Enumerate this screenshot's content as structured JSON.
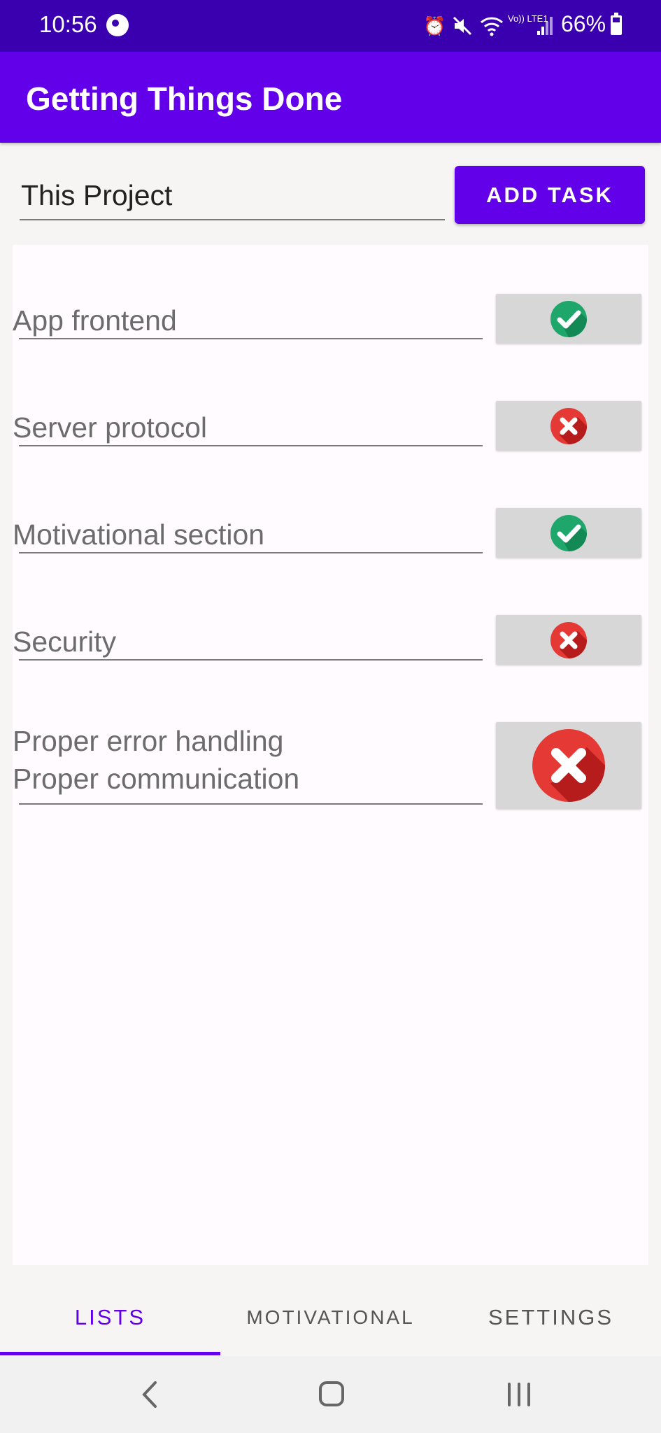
{
  "status_bar": {
    "time": "10:56",
    "battery": "66%",
    "volte_label": "Vo)) LTE1",
    "icons": [
      "app-notification-icon",
      "alarm-icon",
      "mute-icon",
      "wifi-icon",
      "volte-icon",
      "signal-icon",
      "battery-icon"
    ]
  },
  "app_bar": {
    "title": "Getting Things Done"
  },
  "project": {
    "name": "This Project",
    "add_task_label": "ADD TASK"
  },
  "tasks": [
    {
      "name": "App frontend",
      "done": true
    },
    {
      "name": "Server protocol",
      "done": false
    },
    {
      "name": "Motivational section",
      "done": true
    },
    {
      "name": "Security",
      "done": false
    },
    {
      "name": "Proper error handling\nProper communication",
      "done": false
    }
  ],
  "tabs": [
    {
      "label": "LISTS",
      "selected": true
    },
    {
      "label": "MOTIVATIONAL",
      "selected": false
    },
    {
      "label": "SETTINGS",
      "selected": false
    }
  ],
  "colors": {
    "primary": "#6200ea",
    "status_bar": "#3a00b0",
    "done_green": "#1fa66b",
    "not_done_red": "#e53935",
    "toggle_bg": "#d6d7d6"
  },
  "nav_bar": {
    "icons": [
      "back-icon",
      "home-icon",
      "recents-icon"
    ]
  }
}
